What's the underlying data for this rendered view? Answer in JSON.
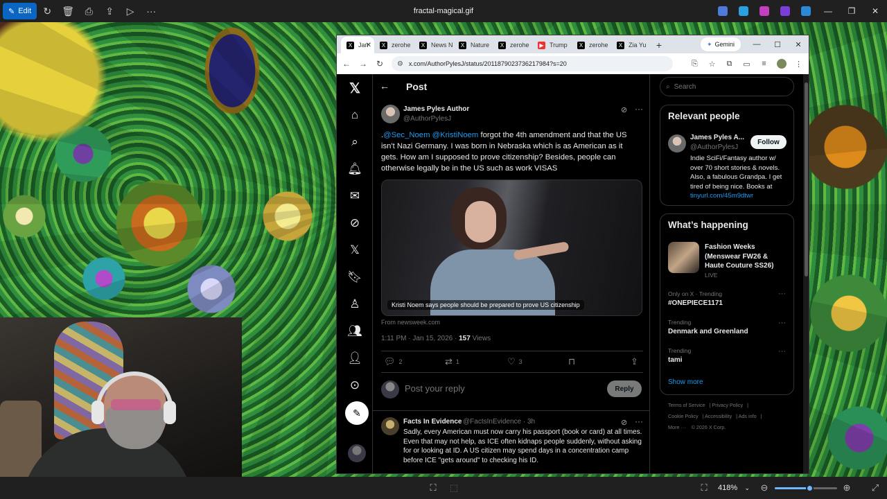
{
  "viewer": {
    "title": "fractal-magical.gif",
    "edit_label": "Edit",
    "zoom_level": "418%",
    "zoom_fraction": 0.55
  },
  "browser": {
    "tabs": [
      {
        "label": "Jan",
        "icon": "x-icon",
        "active": true
      },
      {
        "label": "zerohe",
        "icon": "x-icon"
      },
      {
        "label": "News N",
        "icon": "x-icon"
      },
      {
        "label": "Nature",
        "icon": "x-icon"
      },
      {
        "label": "zerohe",
        "icon": "x-icon"
      },
      {
        "label": "Trump",
        "icon": "youtube-icon"
      },
      {
        "label": "zerohe",
        "icon": "x-icon"
      },
      {
        "label": "Zia Yu",
        "icon": "x-icon"
      }
    ],
    "gemini_label": "Gemini",
    "url": "x.com/AuthorPylesJ/status/2011879023736217984?s=20"
  },
  "post": {
    "header_title": "Post",
    "author_name": "James Pyles Author",
    "author_handle": "@AuthorPylesJ",
    "text_prefix": ".",
    "mention1": "@Sec_Noem",
    "mention2": "@KristiNoem",
    "text_body": " forgot the 4th amendment and that the US isn't Nazi Germany. I was born in Nebraska which is as American as it gets. How am I supposed to prove citizenship? Besides, people can otherwise legally be in the US such as work VISAS",
    "media_caption": "Kristi Noem says people should be prepared to prove US citizenship",
    "media_source": "From newsweek.com",
    "time": "1:11 PM · Jan 15, 2026 · ",
    "views_count": "157",
    "views_label": " Views",
    "replies": "2",
    "reposts": "1",
    "likes": "3",
    "reply_placeholder": "Post your reply",
    "reply_button": "Reply"
  },
  "comment": {
    "name": "Facts In Evidence",
    "handle": "@FactsInEvidence · 3h",
    "line1": "Sadly, every American must now carry his passport (book or card) at all times.",
    "line2": "Even that may not help, as ICE often kidnaps people suddenly, without asking for or looking at ID.  A US citizen may spend days in a concentration camp before ICE \"gets around\" to checking his ID."
  },
  "sidebar": {
    "search_placeholder": "Search",
    "relevant_title": "Relevant people",
    "rp_name": "James Pyles A...",
    "rp_handle": "@AuthorPylesJ",
    "follow_label": "Follow",
    "rp_bio": "Indie SciFi/Fantasy author w/ over 70 short stories & novels. Also, a fabulous Grandpa. I get tired of being nice. Books at ",
    "rp_link": "tinyurl.com/45m9dtwr",
    "happening_title": "What’s happening",
    "feature_title": "Fashion Weeks (Menswear FW26 & Haute Couture SS26)",
    "feature_live": "LIVE",
    "trends": [
      {
        "meta": "Only on X · Trending",
        "name": "#ONEPIECE1171"
      },
      {
        "meta": "Trending",
        "name": "Denmark and Greenland"
      },
      {
        "meta": "Trending",
        "name": "tami"
      }
    ],
    "show_more": "Show more",
    "footer": {
      "terms": "Terms of Service",
      "privacy": "Privacy Policy",
      "cookie": "Cookie Policy",
      "accessibility": "Accessibility",
      "ads": "Ads info",
      "more": "More ···",
      "copyright": "© 2026 X Corp."
    }
  }
}
